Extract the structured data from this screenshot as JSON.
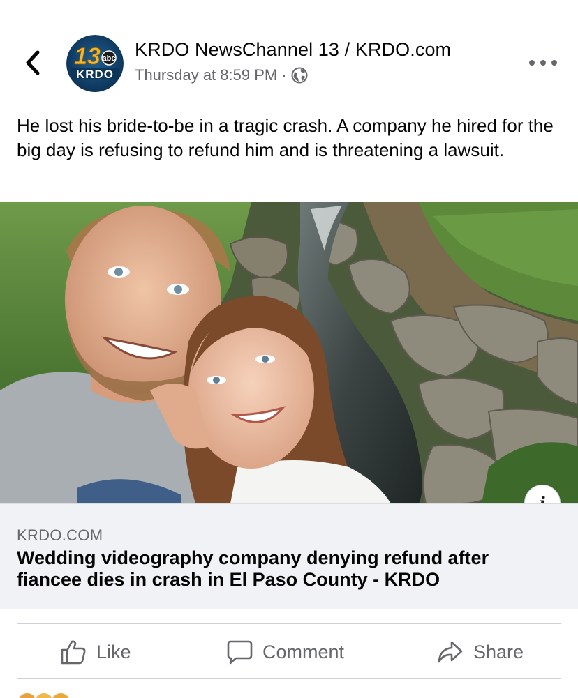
{
  "post": {
    "page_name": "KRDO NewsChannel 13 / KRDO.com",
    "timestamp": "Thursday at 8:59 PM",
    "separator": "·",
    "text": "He lost his bride-to-be in a tragic crash. A company he hired for the big day is refusing to refund him and is threatening a lawsuit.",
    "avatar": {
      "number": "13",
      "network": "abc",
      "station": "KRDO"
    },
    "icons": {
      "back": "chevron-left-icon",
      "privacy": "globe-icon",
      "more": "more-dots-icon",
      "info": "info-icon"
    }
  },
  "link_preview": {
    "domain": "KRDO.COM",
    "title": "Wedding videography company denying refund after fiancee dies in crash in El Paso County - KRDO"
  },
  "actions": {
    "like_label": "Like",
    "comment_label": "Comment",
    "share_label": "Share"
  },
  "colors": {
    "secondary_text": "#65676b",
    "primary_text": "#050505",
    "link_box_bg": "#f0f2f5",
    "divider": "#ced0d4"
  }
}
